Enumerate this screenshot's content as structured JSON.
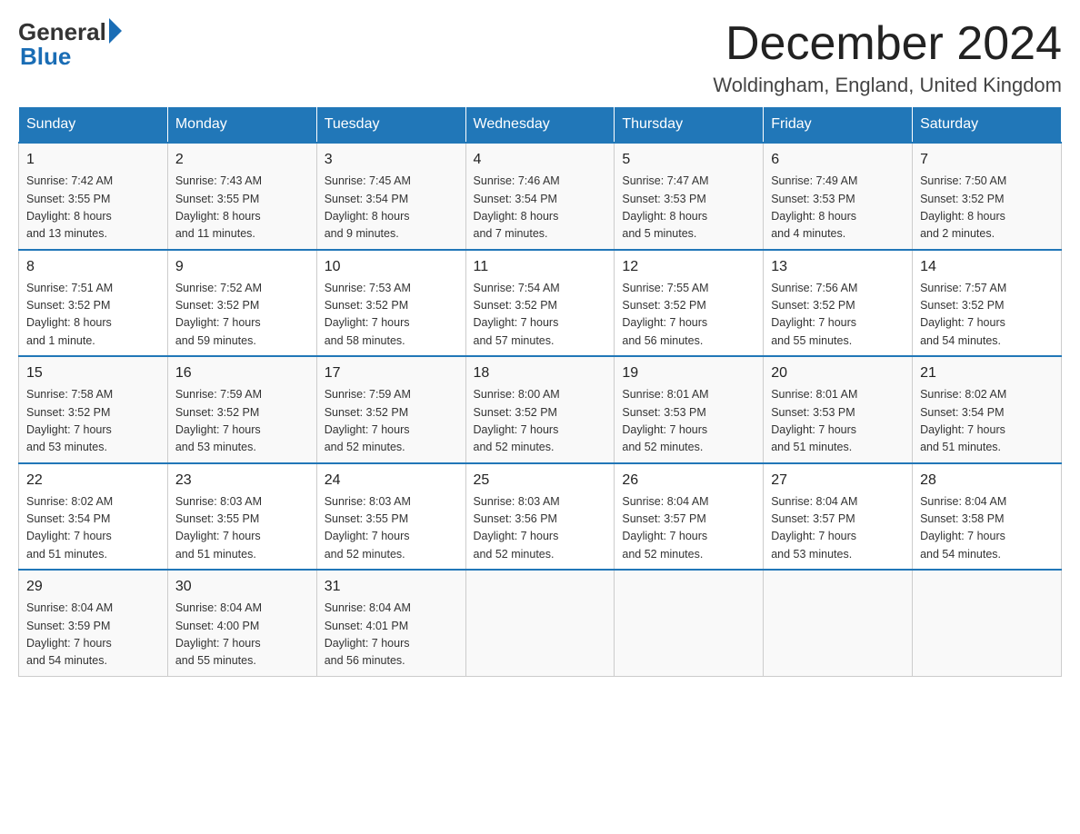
{
  "logo": {
    "text_general": "General",
    "text_blue": "Blue"
  },
  "title": "December 2024",
  "location": "Woldingham, England, United Kingdom",
  "days_of_week": [
    "Sunday",
    "Monday",
    "Tuesday",
    "Wednesday",
    "Thursday",
    "Friday",
    "Saturday"
  ],
  "weeks": [
    [
      {
        "day": "1",
        "sunrise": "Sunrise: 7:42 AM",
        "sunset": "Sunset: 3:55 PM",
        "daylight": "Daylight: 8 hours",
        "daylight2": "and 13 minutes."
      },
      {
        "day": "2",
        "sunrise": "Sunrise: 7:43 AM",
        "sunset": "Sunset: 3:55 PM",
        "daylight": "Daylight: 8 hours",
        "daylight2": "and 11 minutes."
      },
      {
        "day": "3",
        "sunrise": "Sunrise: 7:45 AM",
        "sunset": "Sunset: 3:54 PM",
        "daylight": "Daylight: 8 hours",
        "daylight2": "and 9 minutes."
      },
      {
        "day": "4",
        "sunrise": "Sunrise: 7:46 AM",
        "sunset": "Sunset: 3:54 PM",
        "daylight": "Daylight: 8 hours",
        "daylight2": "and 7 minutes."
      },
      {
        "day": "5",
        "sunrise": "Sunrise: 7:47 AM",
        "sunset": "Sunset: 3:53 PM",
        "daylight": "Daylight: 8 hours",
        "daylight2": "and 5 minutes."
      },
      {
        "day": "6",
        "sunrise": "Sunrise: 7:49 AM",
        "sunset": "Sunset: 3:53 PM",
        "daylight": "Daylight: 8 hours",
        "daylight2": "and 4 minutes."
      },
      {
        "day": "7",
        "sunrise": "Sunrise: 7:50 AM",
        "sunset": "Sunset: 3:52 PM",
        "daylight": "Daylight: 8 hours",
        "daylight2": "and 2 minutes."
      }
    ],
    [
      {
        "day": "8",
        "sunrise": "Sunrise: 7:51 AM",
        "sunset": "Sunset: 3:52 PM",
        "daylight": "Daylight: 8 hours",
        "daylight2": "and 1 minute."
      },
      {
        "day": "9",
        "sunrise": "Sunrise: 7:52 AM",
        "sunset": "Sunset: 3:52 PM",
        "daylight": "Daylight: 7 hours",
        "daylight2": "and 59 minutes."
      },
      {
        "day": "10",
        "sunrise": "Sunrise: 7:53 AM",
        "sunset": "Sunset: 3:52 PM",
        "daylight": "Daylight: 7 hours",
        "daylight2": "and 58 minutes."
      },
      {
        "day": "11",
        "sunrise": "Sunrise: 7:54 AM",
        "sunset": "Sunset: 3:52 PM",
        "daylight": "Daylight: 7 hours",
        "daylight2": "and 57 minutes."
      },
      {
        "day": "12",
        "sunrise": "Sunrise: 7:55 AM",
        "sunset": "Sunset: 3:52 PM",
        "daylight": "Daylight: 7 hours",
        "daylight2": "and 56 minutes."
      },
      {
        "day": "13",
        "sunrise": "Sunrise: 7:56 AM",
        "sunset": "Sunset: 3:52 PM",
        "daylight": "Daylight: 7 hours",
        "daylight2": "and 55 minutes."
      },
      {
        "day": "14",
        "sunrise": "Sunrise: 7:57 AM",
        "sunset": "Sunset: 3:52 PM",
        "daylight": "Daylight: 7 hours",
        "daylight2": "and 54 minutes."
      }
    ],
    [
      {
        "day": "15",
        "sunrise": "Sunrise: 7:58 AM",
        "sunset": "Sunset: 3:52 PM",
        "daylight": "Daylight: 7 hours",
        "daylight2": "and 53 minutes."
      },
      {
        "day": "16",
        "sunrise": "Sunrise: 7:59 AM",
        "sunset": "Sunset: 3:52 PM",
        "daylight": "Daylight: 7 hours",
        "daylight2": "and 53 minutes."
      },
      {
        "day": "17",
        "sunrise": "Sunrise: 7:59 AM",
        "sunset": "Sunset: 3:52 PM",
        "daylight": "Daylight: 7 hours",
        "daylight2": "and 52 minutes."
      },
      {
        "day": "18",
        "sunrise": "Sunrise: 8:00 AM",
        "sunset": "Sunset: 3:52 PM",
        "daylight": "Daylight: 7 hours",
        "daylight2": "and 52 minutes."
      },
      {
        "day": "19",
        "sunrise": "Sunrise: 8:01 AM",
        "sunset": "Sunset: 3:53 PM",
        "daylight": "Daylight: 7 hours",
        "daylight2": "and 52 minutes."
      },
      {
        "day": "20",
        "sunrise": "Sunrise: 8:01 AM",
        "sunset": "Sunset: 3:53 PM",
        "daylight": "Daylight: 7 hours",
        "daylight2": "and 51 minutes."
      },
      {
        "day": "21",
        "sunrise": "Sunrise: 8:02 AM",
        "sunset": "Sunset: 3:54 PM",
        "daylight": "Daylight: 7 hours",
        "daylight2": "and 51 minutes."
      }
    ],
    [
      {
        "day": "22",
        "sunrise": "Sunrise: 8:02 AM",
        "sunset": "Sunset: 3:54 PM",
        "daylight": "Daylight: 7 hours",
        "daylight2": "and 51 minutes."
      },
      {
        "day": "23",
        "sunrise": "Sunrise: 8:03 AM",
        "sunset": "Sunset: 3:55 PM",
        "daylight": "Daylight: 7 hours",
        "daylight2": "and 51 minutes."
      },
      {
        "day": "24",
        "sunrise": "Sunrise: 8:03 AM",
        "sunset": "Sunset: 3:55 PM",
        "daylight": "Daylight: 7 hours",
        "daylight2": "and 52 minutes."
      },
      {
        "day": "25",
        "sunrise": "Sunrise: 8:03 AM",
        "sunset": "Sunset: 3:56 PM",
        "daylight": "Daylight: 7 hours",
        "daylight2": "and 52 minutes."
      },
      {
        "day": "26",
        "sunrise": "Sunrise: 8:04 AM",
        "sunset": "Sunset: 3:57 PM",
        "daylight": "Daylight: 7 hours",
        "daylight2": "and 52 minutes."
      },
      {
        "day": "27",
        "sunrise": "Sunrise: 8:04 AM",
        "sunset": "Sunset: 3:57 PM",
        "daylight": "Daylight: 7 hours",
        "daylight2": "and 53 minutes."
      },
      {
        "day": "28",
        "sunrise": "Sunrise: 8:04 AM",
        "sunset": "Sunset: 3:58 PM",
        "daylight": "Daylight: 7 hours",
        "daylight2": "and 54 minutes."
      }
    ],
    [
      {
        "day": "29",
        "sunrise": "Sunrise: 8:04 AM",
        "sunset": "Sunset: 3:59 PM",
        "daylight": "Daylight: 7 hours",
        "daylight2": "and 54 minutes."
      },
      {
        "day": "30",
        "sunrise": "Sunrise: 8:04 AM",
        "sunset": "Sunset: 4:00 PM",
        "daylight": "Daylight: 7 hours",
        "daylight2": "and 55 minutes."
      },
      {
        "day": "31",
        "sunrise": "Sunrise: 8:04 AM",
        "sunset": "Sunset: 4:01 PM",
        "daylight": "Daylight: 7 hours",
        "daylight2": "and 56 minutes."
      },
      {
        "day": "",
        "sunrise": "",
        "sunset": "",
        "daylight": "",
        "daylight2": ""
      },
      {
        "day": "",
        "sunrise": "",
        "sunset": "",
        "daylight": "",
        "daylight2": ""
      },
      {
        "day": "",
        "sunrise": "",
        "sunset": "",
        "daylight": "",
        "daylight2": ""
      },
      {
        "day": "",
        "sunrise": "",
        "sunset": "",
        "daylight": "",
        "daylight2": ""
      }
    ]
  ]
}
